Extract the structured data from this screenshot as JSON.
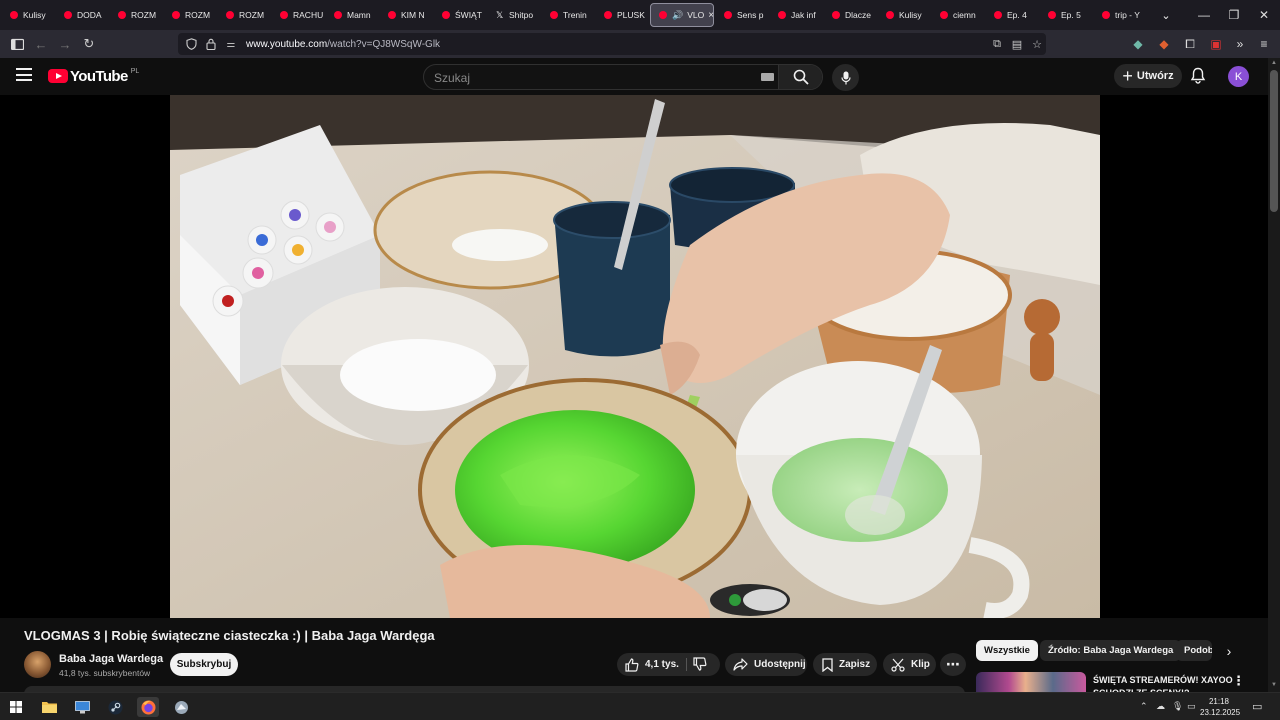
{
  "browser": {
    "tabs": [
      {
        "label": "Kulisy"
      },
      {
        "label": "DODA"
      },
      {
        "label": "ROZM"
      },
      {
        "label": "ROZM"
      },
      {
        "label": "ROZM"
      },
      {
        "label": "RACHU"
      },
      {
        "label": "Mamn"
      },
      {
        "label": "KIM N"
      },
      {
        "label": "ŚWIĄT"
      },
      {
        "label": "Shitpo"
      },
      {
        "label": "Trenin"
      },
      {
        "label": "PLUSK"
      },
      {
        "label": "VLO"
      },
      {
        "label": "Sens p"
      },
      {
        "label": "Jak inf"
      },
      {
        "label": "Dlacze"
      },
      {
        "label": "Kulisy"
      },
      {
        "label": "ciemn"
      },
      {
        "label": "Ep. 4"
      },
      {
        "label": "Ep. 5"
      },
      {
        "label": "trip - Y"
      }
    ],
    "url_domain": "www.youtube.com",
    "url_path": "/watch?v=QJ8WSqW-Glk"
  },
  "youtube": {
    "logo_word": "YouTube",
    "country_code": "PL",
    "search_placeholder": "Szukaj",
    "create_label": "Utwórz",
    "avatar_letter": "K",
    "accent": "#ff0033",
    "avatar_color": "#8a4fd6"
  },
  "video": {
    "title": "VLOGMAS 3 | Robię świąteczne ciasteczka :) | Baba Jaga Wardęga",
    "channel_name": "Baba Jaga Wardega",
    "subscribers": "41,8 tys. subskrybentów",
    "subscribe_label": "Subskrybuj",
    "likes": "4,1 tys.",
    "share_label": "Udostępnij",
    "save_label": "Zapisz",
    "clip_label": "Klip"
  },
  "sidebar": {
    "chips": [
      "Wszystkie",
      "Źródło: Baba Jaga Wardega",
      "Podob"
    ],
    "recommended_title": "ŚWIĘTA STREAMERÓW! XAYOO SCHODZI ZE SCENY!?"
  },
  "taskbar": {
    "time": "21:18",
    "date": "23.12.2025"
  }
}
